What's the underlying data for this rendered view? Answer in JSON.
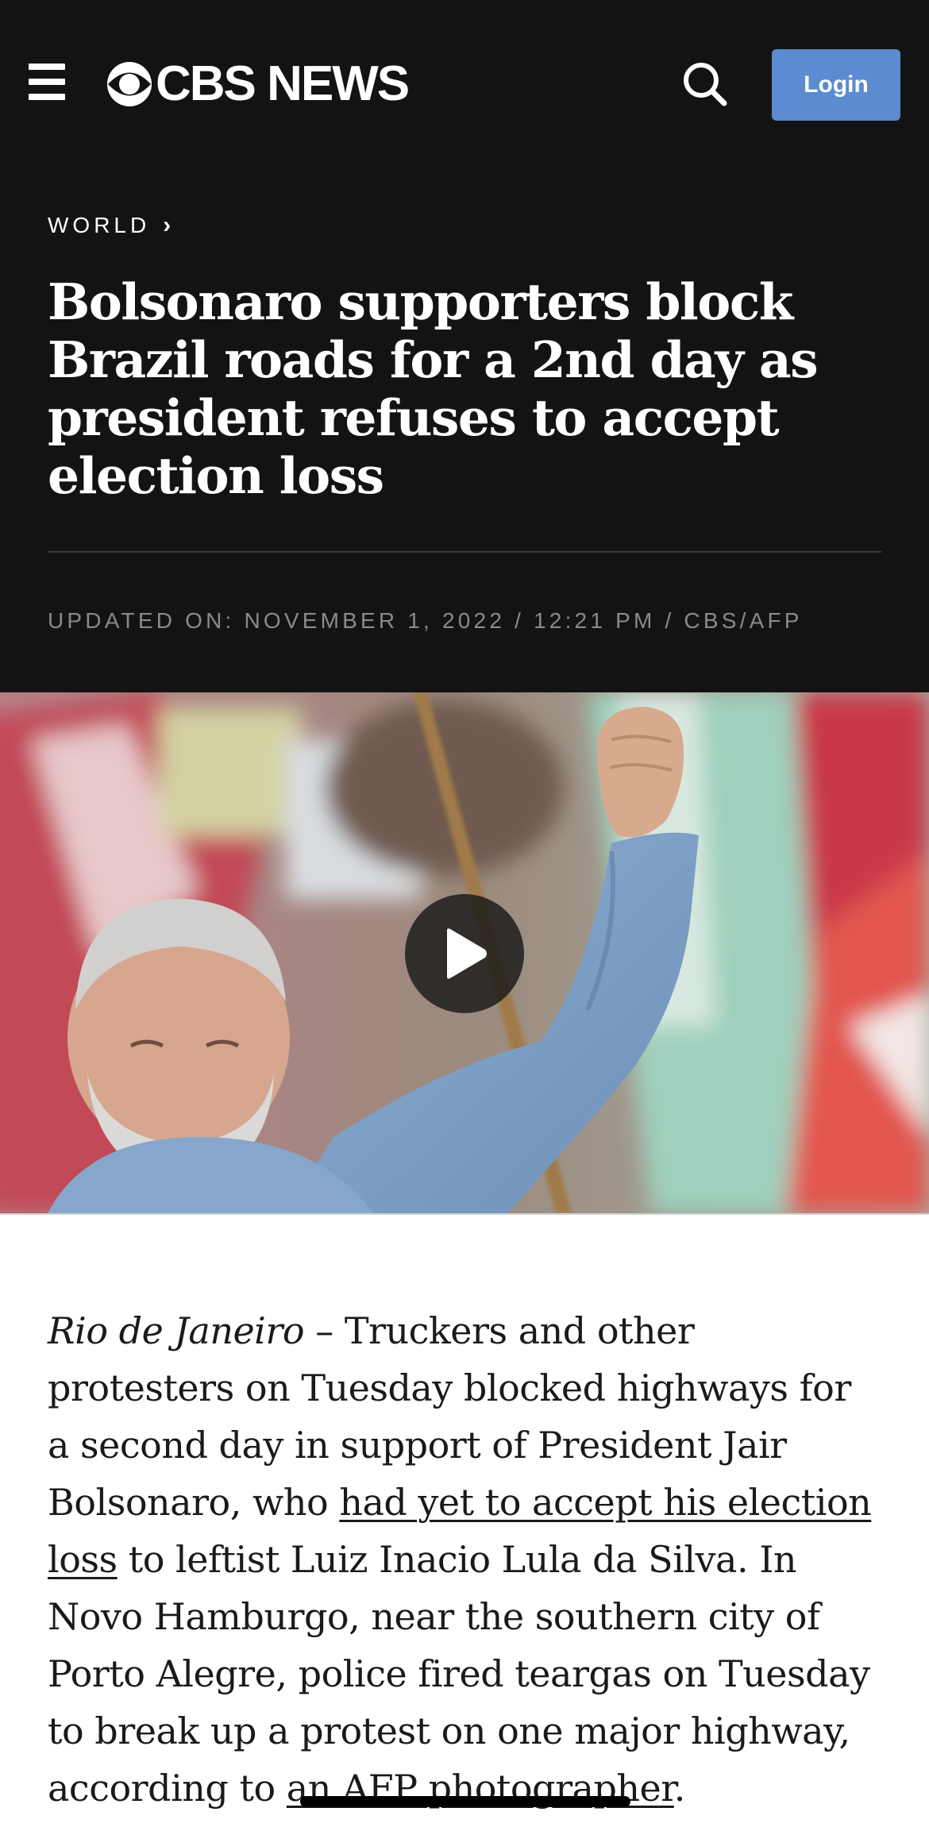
{
  "header": {
    "brand": "CBS NEWS",
    "login_label": "Login",
    "icons": {
      "menu": "hamburger-menu-icon",
      "logo": "cbs-eye-logo-icon",
      "search": "search-icon"
    }
  },
  "section": {
    "label": "WORLD",
    "chevron": "›"
  },
  "headline": "Bolsonaro supporters block Brazil roads for a 2nd day as president refuses to accept election loss",
  "byline": "UPDATED ON: NOVEMBER 1, 2022 / 12:21 PM / CBS/AFP",
  "video": {
    "icon": "play-icon"
  },
  "article": {
    "dateline": "Rio de Janeiro",
    "dash": " – ",
    "text_before_link": "Truckers and other protesters on Tuesday blocked highways for a second day in support of President Jair Bolsonaro, who ",
    "link1": "had yet to accept his election loss",
    "text_between": " to leftist Luiz Inacio Lula da Silva. In Novo Hamburgo, near the southern city of Porto Alegre, police fired teargas on Tuesday to break up a protest on one major highway, according to ",
    "link2": "an AFP photographer",
    "text_after": "."
  },
  "colors": {
    "header_bg": "#131314",
    "login_button": "#5b8bd0",
    "byline_text": "#8a8a8c",
    "body_text": "#1a1a1a"
  }
}
